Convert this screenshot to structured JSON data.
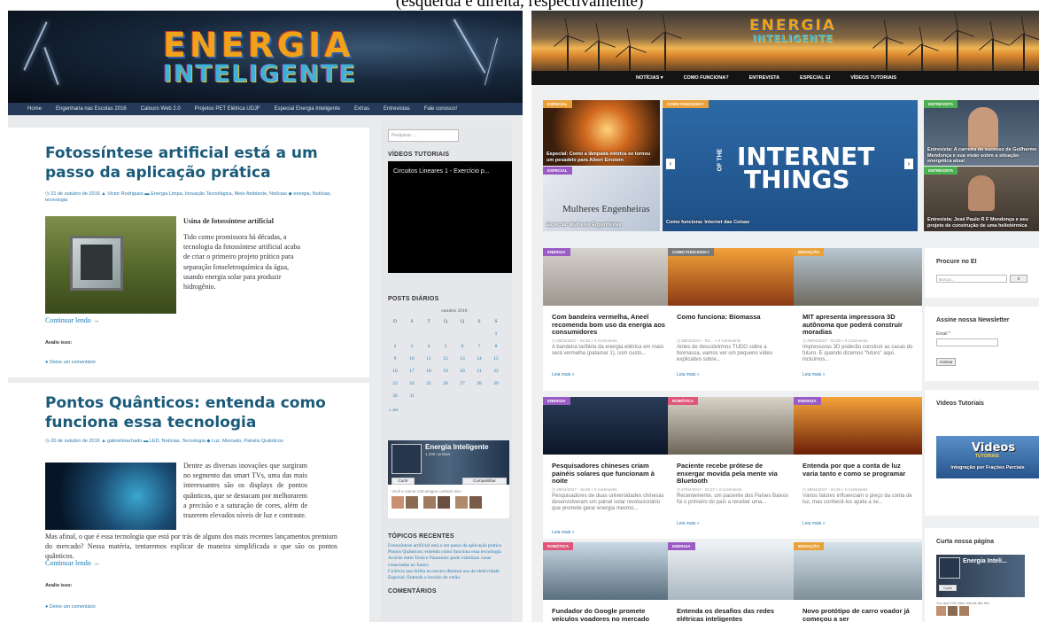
{
  "caption": "(esquerda e direita, respectivamente)",
  "left": {
    "logo": {
      "line1": "ENERGIA",
      "line2": "INTELIGENTE"
    },
    "nav": [
      "Home",
      "Engenharia nas Escolas 2016",
      "Calouro Web 2.0",
      "Projetos PET Elétrica UDJF",
      "Especial Energia Inteligente",
      "Extras",
      "Entrevistas",
      "Fale conosco!"
    ],
    "post1": {
      "title": "Fotossíntese artificial está a um passo da aplicação prática",
      "meta": "◷ 21 de outubro de 2016   ▲ Victor Rodrigues   ▬ Energia Limpa, Inovação Tecnológica, Meio Ambiente, Notícias   ◆ energia, Notícias, tecnologia",
      "subtitle": "Usina de fotossíntese artificial",
      "text": "Tido como promissora há décadas, a tecnologia da fotossíntese artificial acaba de criar o primeiro projeto prático para separação fotoeletroquímica da água, usando energia solar para produzir hidrogênio.",
      "more": "Continuar lendo →",
      "avalie": "Avalie isso:",
      "comment": "● Deixe um comentário"
    },
    "post2": {
      "title": "Pontos Quânticos: entenda como funciona essa tecnologia",
      "meta": "◷ 20 de outubro de 2016   ▲ gabrielmachado   ▬ LED, Notícias, Tecnologia   ◆ Luz, Mercado, Painéis Quânticos",
      "text1": "Dentre as diversas inovações que surgiram no segmento das smart TVs, uma das mais interessantes são os displays de pontos quânticos, que se destacam por melhorarem a precisão e a saturação de cores, além de trazerem elevados níveis de luz e contraste.",
      "text2": "Mas afinal, o que é essa tecnologia que está por trás de alguns dos mais recentes lançamentos premium do mercado? Nessa matéria, tentaremos explicar de maneira simplificada o que são os pontos quânticos.",
      "more": "Continuar lendo →",
      "avalie": "Avalie isso:",
      "comment": "● Deixe um comentário"
    },
    "sidebar": {
      "search_placeholder": "Pesquisar …",
      "videos_title": "VÍDEOS TUTORIAIS",
      "video_caption": "Circuitos Lineares 1 - Exercício p...",
      "posts_title": "POSTS DIÁRIOS",
      "calendar": {
        "caption": "outubro 2016",
        "weekdays": [
          "D",
          "S",
          "T",
          "Q",
          "Q",
          "S",
          "S"
        ],
        "days": [
          "1",
          "2",
          "3",
          "4",
          "5",
          "6",
          "7",
          "8",
          "9",
          "10",
          "11",
          "12",
          "13",
          "14",
          "15",
          "16",
          "17",
          "18",
          "19",
          "20",
          "21",
          "22",
          "23",
          "24",
          "25",
          "26",
          "27",
          "28",
          "29",
          "30",
          "31"
        ],
        "prev": "« set"
      },
      "fb": {
        "name": "Energia Inteligente",
        "likes": "1.335 curtidas",
        "btn1": "Curtir",
        "btn2": "Compartilhar",
        "friends": "Você e outros 129 amigos curtiram isso"
      },
      "topics_title": "TÓPICOS RECENTES",
      "topics": [
        "Fotossíntese artificial está a um passo da aplicação prática",
        "Pontos Quânticos: entenda como funciona essa tecnologia",
        "Acordo entre Tesla e Panasonic pode viabilizar casas conectadas no futuro",
        "Ciclovia que brilha no escuro diminui uso de eletricidade",
        "Especial: Entenda o horário de verão"
      ],
      "comments_title": "COMENTÁRIOS"
    }
  },
  "right": {
    "logo": {
      "line1": "ENERGIA",
      "line2": "INTELIGENTE"
    },
    "nav": [
      "NOTÍCIAS ▾",
      "COMO FUNCIONA?",
      "ENTREVISTA",
      "ESPECIAL EI",
      "VÍDEOS TUTORIAIS"
    ],
    "featured": {
      "f1": {
        "tag": "ESPECIAL",
        "caption": "Especial: Como a lâmpada elétrica se tornou um pesadelo para Albert Einstein"
      },
      "f2": {
        "tag": "ESPECIAL",
        "overlay": "Mulheres Engenheiras",
        "caption": "Especial: Mulheres Engenheiras"
      },
      "f3": {
        "tag": "COMO FUNCIONA?",
        "line1": "INTERNET",
        "line2": "THINGS",
        "of": "OF THE",
        "caption": "Como funciona: Internet das Coisas"
      },
      "f4": {
        "tag": "ENTREVISTA",
        "caption": "Entrevista: A carreira de sucesso de Guilherme Mendonça e sua visão sobre a situação energética atual"
      },
      "f5": {
        "tag": "ENTREVISTA",
        "caption": "Entrevista: José Paulo R F Mendonça e seu projeto de construção de uma heliotérmica"
      }
    },
    "cards": [
      {
        "tag": "ENERGIA",
        "title": "Com bandeira vermelha, Aneel recomenda bom uso da energia aos consumidores",
        "meta": "◷ 28/04/2017 - 03:28   ⌕ 0 Comments",
        "excerpt": "A bandeira tarifária da energia elétrica em maio será vermelha (patamar 1), com custo...",
        "more": "Leia mais »"
      },
      {
        "tag": "COMO FUNCIONA?",
        "title": "Como funciona: Biomassa",
        "meta": "◷ 28/04/2017 - 03:... ⌕ 0 Comments",
        "excerpt": "Antes de descobrirmos TUDO sobre a biomassa, vamos ver um pequeno vídeo explicativo sobre...",
        "more": "Leia mais »"
      },
      {
        "tag": "INOVAÇÃO",
        "title": "MIT apresenta impressora 3D autônoma que poderá construir moradias",
        "meta": "◷ 28/04/2017 - 04:26   ⌕ 0 Comments",
        "excerpt": "Impressoras 3D poderão construir as casas do futuro. E quando dizemos \"futuro\" aqui, incluímos...",
        "more": "Leia mais »"
      },
      {
        "tag": "ENERGIA",
        "title": "Pesquisadores chineses criam painéis solares que funcionam à noite",
        "meta": "◷ 28/04/2017 - 15:28   ⌕ 0 Comments",
        "excerpt": "Pesquisadores de duas universidades chinesas desenvolveram um painel solar revolucionário que promete gerar energia mesmo...",
        "more": "Leia mais »"
      },
      {
        "tag": "ROBÓTICA",
        "title": "Paciente recebe prótese de enxergar movida pela mente via Bluetooth",
        "meta": "◷ 27/04/2017 - 03:27   ⌕ 0 Comments",
        "excerpt": "Recentemente, um paciente dos Países Baixos foi o primeiro do país a receber uma...",
        "more": "Leia mais »"
      },
      {
        "tag": "ENERGIA",
        "title": "Entenda por que a conta de luz varia tanto e como se programar",
        "meta": "◷ 28/04/2017 - 04:26   ⌕ 0 Comments",
        "excerpt": "Vários fatores influenciam o preço da conta de luz, mas conhecê-los ajuda a se...",
        "more": "Leia mais »"
      },
      {
        "tag": "ROBÓTICA",
        "title": "Fundador do Google promete veículos voadores no mercado",
        "meta": "",
        "excerpt": "",
        "more": ""
      },
      {
        "tag": "ENERGIA",
        "title": "Entenda os desafios das redes elétricas inteligentes",
        "meta": "",
        "excerpt": "",
        "more": ""
      },
      {
        "tag": "INOVAÇÃO",
        "title": "Novo protótipo de carro voador já começou a ser",
        "meta": "",
        "excerpt": "",
        "more": ""
      }
    ],
    "sidebar": {
      "search_title": "Procure no EI",
      "search_placeholder": "Buscar...",
      "search_btn": "Ir",
      "news_title": "Assine nossa Newsletter",
      "email_label": "Email *",
      "subscribe": "Assinar",
      "videos_title": "Vídeos Tutoriais",
      "video_word": "Videos",
      "video_word2": "TUTORIAIS",
      "video_caption": "Integração por Frações Parciais",
      "like_title": "Curta nossa página",
      "fb_name": "Energia Inteli...",
      "fb_like": "Curtir",
      "fb_friends": "You and 128 other friends like this"
    }
  }
}
